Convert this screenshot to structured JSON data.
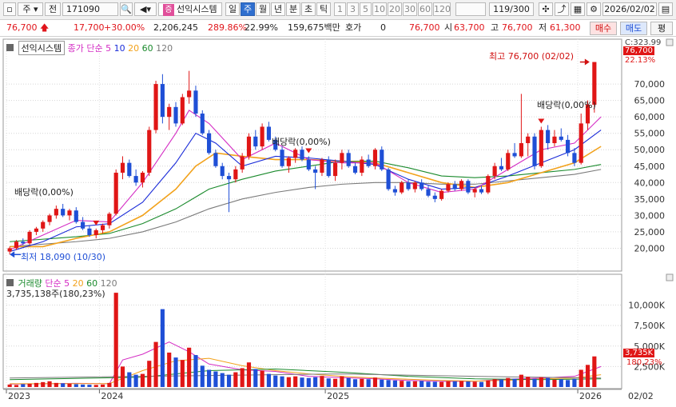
{
  "toolbar": {
    "market": "주",
    "prev_label": "전",
    "code": "171090",
    "indicator_btn": "선익시스템",
    "periods": [
      "일",
      "주",
      "월",
      "년",
      "분",
      "초",
      "틱"
    ],
    "selected_period": "주",
    "minute_options": [
      "1",
      "3",
      "5",
      "10",
      "20",
      "30",
      "60",
      "120"
    ],
    "count": "119/300",
    "date": "2026/02/02"
  },
  "quote": {
    "price": "76,700",
    "change": "17,700",
    "change_pct": "+30.00%",
    "volume": "2,206,245",
    "vol_ratio": "289.86%",
    "turnover": "22.99%",
    "amount": "159,675백만",
    "hoga_label": "호가",
    "hoga_val": "0",
    "current": "76,700",
    "open_label": "시",
    "open": "63,700",
    "high_label": "고",
    "high": "76,700",
    "low_label": "저",
    "low": "61,300",
    "buy": "매수",
    "sell": "매도",
    "eval": "평"
  },
  "price_panel": {
    "title": "선익시스템",
    "ma_label": "종가 단순",
    "ma_periods": [
      "5",
      "10",
      "20",
      "60",
      "120"
    ],
    "ma_colors": [
      "#d42cc4",
      "#1a2bd8",
      "#f2a21c",
      "#1a8a2c",
      "#7a7a7a"
    ],
    "high_note": "최고 76,700 (02/02)",
    "low_note": "최저 18,090 (10/30)",
    "dividend_notes": [
      "배당락(0,00%)",
      "배당락(0,00%)",
      "배당락(0,00%)"
    ],
    "right_top": "C:323.99",
    "price_tag": "76,700",
    "pct_tag": "22.13%",
    "y_labels": [
      "70,000",
      "65,000",
      "60,000",
      "55,000",
      "50,000",
      "45,000",
      "40,000",
      "35,000",
      "30,000",
      "25,000",
      "20,000"
    ]
  },
  "volume_panel": {
    "title": "거래량",
    "ma_label": "단순",
    "ma_periods": [
      "5",
      "20",
      "60",
      "120"
    ],
    "last_vol": "3,735,138주(180,23%)",
    "vol_tag": "3,735K",
    "vol_pct": "180,23%",
    "y_labels": [
      "10,000K",
      "7,500K",
      "5,000K",
      "2,500K"
    ]
  },
  "x_axis": {
    "labels": [
      "2023",
      "2024",
      "2025",
      "2026"
    ],
    "right_label": "02/02"
  },
  "chart_data": {
    "type": "candlestick",
    "price_range": [
      15000,
      80000
    ],
    "volume_range_k": [
      0,
      12000
    ],
    "candles": [
      {
        "o": 19000,
        "h": 20500,
        "l": 18090,
        "c": 20000
      },
      {
        "o": 20000,
        "h": 22500,
        "l": 19500,
        "c": 22000
      },
      {
        "o": 22000,
        "h": 23000,
        "l": 21000,
        "c": 21500
      },
      {
        "o": 21500,
        "h": 25500,
        "l": 21000,
        "c": 25000
      },
      {
        "o": 25000,
        "h": 26500,
        "l": 24000,
        "c": 26000
      },
      {
        "o": 26000,
        "h": 28500,
        "l": 25000,
        "c": 28000
      },
      {
        "o": 28000,
        "h": 30500,
        "l": 27000,
        "c": 30000
      },
      {
        "o": 30000,
        "h": 33000,
        "l": 29000,
        "c": 32000
      },
      {
        "o": 32000,
        "h": 33500,
        "l": 29500,
        "c": 30000
      },
      {
        "o": 30000,
        "h": 32000,
        "l": 28500,
        "c": 31500
      },
      {
        "o": 31500,
        "h": 32500,
        "l": 27500,
        "c": 28000
      },
      {
        "o": 28000,
        "h": 29500,
        "l": 25500,
        "c": 26000
      },
      {
        "o": 26000,
        "h": 27000,
        "l": 23500,
        "c": 24000
      },
      {
        "o": 24000,
        "h": 26000,
        "l": 23000,
        "c": 25500
      },
      {
        "o": 25500,
        "h": 27500,
        "l": 24500,
        "c": 27000
      },
      {
        "o": 27000,
        "h": 31000,
        "l": 26000,
        "c": 30500
      },
      {
        "o": 30500,
        "h": 44000,
        "l": 30000,
        "c": 43000
      },
      {
        "o": 43000,
        "h": 48000,
        "l": 41000,
        "c": 46000
      },
      {
        "o": 46000,
        "h": 47000,
        "l": 41500,
        "c": 42000
      },
      {
        "o": 42000,
        "h": 44000,
        "l": 39000,
        "c": 40000
      },
      {
        "o": 40000,
        "h": 43500,
        "l": 38500,
        "c": 43000
      },
      {
        "o": 43000,
        "h": 57000,
        "l": 42000,
        "c": 56000
      },
      {
        "o": 56000,
        "h": 71000,
        "l": 55000,
        "c": 70000
      },
      {
        "o": 70000,
        "h": 73000,
        "l": 58000,
        "c": 60000
      },
      {
        "o": 60000,
        "h": 64000,
        "l": 56000,
        "c": 63000
      },
      {
        "o": 63000,
        "h": 64500,
        "l": 57000,
        "c": 58000
      },
      {
        "o": 58000,
        "h": 67000,
        "l": 57500,
        "c": 66000
      },
      {
        "o": 66000,
        "h": 74000,
        "l": 64000,
        "c": 68000
      },
      {
        "o": 68000,
        "h": 69500,
        "l": 60000,
        "c": 61000
      },
      {
        "o": 61000,
        "h": 62000,
        "l": 54500,
        "c": 55000
      },
      {
        "o": 55000,
        "h": 56000,
        "l": 48500,
        "c": 49000
      },
      {
        "o": 49000,
        "h": 50000,
        "l": 44500,
        "c": 45000
      },
      {
        "o": 45000,
        "h": 46000,
        "l": 41000,
        "c": 42000
      },
      {
        "o": 42000,
        "h": 43000,
        "l": 31000,
        "c": 41000
      },
      {
        "o": 41000,
        "h": 45000,
        "l": 40000,
        "c": 44000
      },
      {
        "o": 44000,
        "h": 49000,
        "l": 43000,
        "c": 48000
      },
      {
        "o": 48000,
        "h": 55000,
        "l": 47000,
        "c": 54000
      },
      {
        "o": 54000,
        "h": 56000,
        "l": 50000,
        "c": 51000
      },
      {
        "o": 51000,
        "h": 58000,
        "l": 50000,
        "c": 57000
      },
      {
        "o": 57000,
        "h": 58500,
        "l": 52500,
        "c": 53000
      },
      {
        "o": 53000,
        "h": 54000,
        "l": 49500,
        "c": 50000
      },
      {
        "o": 50000,
        "h": 51000,
        "l": 44500,
        "c": 45000
      },
      {
        "o": 45000,
        "h": 48000,
        "l": 43000,
        "c": 47500
      },
      {
        "o": 47500,
        "h": 50500,
        "l": 46000,
        "c": 50000
      },
      {
        "o": 50000,
        "h": 51000,
        "l": 46500,
        "c": 47000
      },
      {
        "o": 47000,
        "h": 48000,
        "l": 43500,
        "c": 44000
      },
      {
        "o": 44000,
        "h": 45000,
        "l": 38000,
        "c": 43000
      },
      {
        "o": 43000,
        "h": 47500,
        "l": 42000,
        "c": 47000
      },
      {
        "o": 47000,
        "h": 48000,
        "l": 41500,
        "c": 42000
      },
      {
        "o": 42000,
        "h": 47000,
        "l": 40500,
        "c": 46000
      },
      {
        "o": 46000,
        "h": 50000,
        "l": 44000,
        "c": 49000
      },
      {
        "o": 49000,
        "h": 50000,
        "l": 44500,
        "c": 45000
      },
      {
        "o": 45000,
        "h": 46000,
        "l": 42500,
        "c": 43000
      },
      {
        "o": 43000,
        "h": 48000,
        "l": 42000,
        "c": 47000
      },
      {
        "o": 47000,
        "h": 48500,
        "l": 44500,
        "c": 45000
      },
      {
        "o": 45000,
        "h": 50500,
        "l": 44000,
        "c": 50000
      },
      {
        "o": 50000,
        "h": 51000,
        "l": 43500,
        "c": 44000
      },
      {
        "o": 44000,
        "h": 44500,
        "l": 37500,
        "c": 38000
      },
      {
        "o": 38000,
        "h": 39000,
        "l": 36000,
        "c": 37000
      },
      {
        "o": 37000,
        "h": 40500,
        "l": 36500,
        "c": 40000
      },
      {
        "o": 40000,
        "h": 41000,
        "l": 37500,
        "c": 38000
      },
      {
        "o": 38000,
        "h": 40500,
        "l": 37000,
        "c": 40000
      },
      {
        "o": 40000,
        "h": 41000,
        "l": 37500,
        "c": 38000
      },
      {
        "o": 38000,
        "h": 39000,
        "l": 35500,
        "c": 36000
      },
      {
        "o": 36000,
        "h": 37000,
        "l": 34000,
        "c": 35000
      },
      {
        "o": 35000,
        "h": 38000,
        "l": 34500,
        "c": 37500
      },
      {
        "o": 37500,
        "h": 40000,
        "l": 37000,
        "c": 39500
      },
      {
        "o": 39500,
        "h": 40500,
        "l": 37500,
        "c": 38000
      },
      {
        "o": 38000,
        "h": 41000,
        "l": 37500,
        "c": 40500
      },
      {
        "o": 40500,
        "h": 41000,
        "l": 36500,
        "c": 37000
      },
      {
        "o": 37000,
        "h": 38500,
        "l": 35500,
        "c": 38000
      },
      {
        "o": 38000,
        "h": 39000,
        "l": 36500,
        "c": 37000
      },
      {
        "o": 37000,
        "h": 42500,
        "l": 36500,
        "c": 42000
      },
      {
        "o": 42000,
        "h": 46000,
        "l": 41000,
        "c": 45000
      },
      {
        "o": 45000,
        "h": 47500,
        "l": 43500,
        "c": 44000
      },
      {
        "o": 44000,
        "h": 50000,
        "l": 43500,
        "c": 49000
      },
      {
        "o": 49000,
        "h": 52000,
        "l": 47500,
        "c": 48000
      },
      {
        "o": 48000,
        "h": 67000,
        "l": 47500,
        "c": 52000
      },
      {
        "o": 52000,
        "h": 55000,
        "l": 48000,
        "c": 54000
      },
      {
        "o": 54000,
        "h": 55000,
        "l": 44000,
        "c": 45000
      },
      {
        "o": 45000,
        "h": 57000,
        "l": 44500,
        "c": 56000
      },
      {
        "o": 56000,
        "h": 57500,
        "l": 50000,
        "c": 52000
      },
      {
        "o": 52000,
        "h": 56000,
        "l": 51000,
        "c": 54000
      },
      {
        "o": 54000,
        "h": 56500,
        "l": 52500,
        "c": 53000
      },
      {
        "o": 53000,
        "h": 54500,
        "l": 48000,
        "c": 49000
      },
      {
        "o": 49000,
        "h": 50500,
        "l": 45000,
        "c": 46000
      },
      {
        "o": 46000,
        "h": 61000,
        "l": 45500,
        "c": 58000
      },
      {
        "o": 58000,
        "h": 65000,
        "l": 56000,
        "c": 63700
      },
      {
        "o": 63700,
        "h": 76700,
        "l": 61300,
        "c": 76700
      }
    ],
    "volumes_k": [
      300,
      250,
      350,
      400,
      500,
      600,
      700,
      500,
      450,
      400,
      350,
      300,
      280,
      260,
      300,
      500,
      11500,
      2500,
      1800,
      1500,
      1600,
      3200,
      5500,
      9500,
      4200,
      3600,
      3300,
      4800,
      3900,
      2600,
      2100,
      1900,
      1700,
      1500,
      1800,
      2300,
      3000,
      2200,
      2000,
      1600,
      1400,
      1300,
      1200,
      1300,
      1150,
      1100,
      1200,
      1350,
      1050,
      1000,
      1300,
      1100,
      950,
      1000,
      950,
      1150,
      900,
      850,
      800,
      760,
      700,
      700,
      740,
      650,
      640,
      620,
      720,
      700,
      740,
      680,
      640,
      620,
      820,
      950,
      900,
      1100,
      1000,
      1500,
      1250,
      1000,
      1200,
      1100,
      900,
      950,
      850,
      1000,
      2100,
      2700,
      3735
    ],
    "ma_prices": {
      "ma5": [
        [
          0,
          19500
        ],
        [
          5,
          24000
        ],
        [
          10,
          28500
        ],
        [
          15,
          28000
        ],
        [
          20,
          40000
        ],
        [
          25,
          55000
        ],
        [
          27,
          62000
        ],
        [
          30,
          58000
        ],
        [
          35,
          47000
        ],
        [
          40,
          52000
        ],
        [
          45,
          47000
        ],
        [
          50,
          46000
        ],
        [
          55,
          46000
        ],
        [
          60,
          40000
        ],
        [
          65,
          37000
        ],
        [
          70,
          38000
        ],
        [
          75,
          44000
        ],
        [
          80,
          50000
        ],
        [
          85,
          52000
        ],
        [
          89,
          60000
        ]
      ],
      "ma10": [
        [
          0,
          19000
        ],
        [
          5,
          22000
        ],
        [
          10,
          26500
        ],
        [
          15,
          27500
        ],
        [
          20,
          34000
        ],
        [
          25,
          46000
        ],
        [
          28,
          55000
        ],
        [
          31,
          52000
        ],
        [
          35,
          45000
        ],
        [
          40,
          48000
        ],
        [
          45,
          47500
        ],
        [
          50,
          46500
        ],
        [
          55,
          45500
        ],
        [
          60,
          41000
        ],
        [
          65,
          38000
        ],
        [
          70,
          38500
        ],
        [
          75,
          42000
        ],
        [
          80,
          46000
        ],
        [
          85,
          50000
        ],
        [
          89,
          56000
        ]
      ],
      "ma20": [
        [
          0,
          20500
        ],
        [
          5,
          20500
        ],
        [
          10,
          23000
        ],
        [
          15,
          25000
        ],
        [
          20,
          30000
        ],
        [
          25,
          38000
        ],
        [
          28,
          45000
        ],
        [
          31,
          49000
        ],
        [
          35,
          48000
        ],
        [
          40,
          47000
        ],
        [
          45,
          47000
        ],
        [
          50,
          46500
        ],
        [
          55,
          46000
        ],
        [
          60,
          43000
        ],
        [
          65,
          40000
        ],
        [
          70,
          38500
        ],
        [
          75,
          40000
        ],
        [
          80,
          43000
        ],
        [
          85,
          46000
        ],
        [
          89,
          51000
        ]
      ],
      "ma60": [
        [
          0,
          22000
        ],
        [
          10,
          23500
        ],
        [
          15,
          24500
        ],
        [
          20,
          27500
        ],
        [
          25,
          32000
        ],
        [
          30,
          38000
        ],
        [
          35,
          41000
        ],
        [
          40,
          43500
        ],
        [
          45,
          45000
        ],
        [
          50,
          46500
        ],
        [
          55,
          46500
        ],
        [
          60,
          44500
        ],
        [
          65,
          42000
        ],
        [
          70,
          41500
        ],
        [
          75,
          42000
        ],
        [
          80,
          43000
        ],
        [
          85,
          44000
        ],
        [
          89,
          45500
        ]
      ],
      "ma120": [
        [
          0,
          20500
        ],
        [
          10,
          22000
        ],
        [
          15,
          23000
        ],
        [
          20,
          25000
        ],
        [
          25,
          28000
        ],
        [
          30,
          32000
        ],
        [
          35,
          35000
        ],
        [
          40,
          37000
        ],
        [
          45,
          38500
        ],
        [
          50,
          39500
        ],
        [
          55,
          40000
        ],
        [
          60,
          40000
        ],
        [
          65,
          39500
        ],
        [
          70,
          39500
        ],
        [
          75,
          40500
        ],
        [
          80,
          41500
        ],
        [
          85,
          42500
        ],
        [
          89,
          44000
        ]
      ]
    },
    "ma_volumes_k": {
      "ma5": [
        [
          0,
          350
        ],
        [
          10,
          450
        ],
        [
          15,
          400
        ],
        [
          17,
          3300
        ],
        [
          20,
          4000
        ],
        [
          24,
          5500
        ],
        [
          27,
          4300
        ],
        [
          30,
          2800
        ],
        [
          35,
          2100
        ],
        [
          40,
          1900
        ],
        [
          45,
          1300
        ],
        [
          50,
          1150
        ],
        [
          55,
          1000
        ],
        [
          60,
          800
        ],
        [
          65,
          680
        ],
        [
          70,
          700
        ],
        [
          75,
          950
        ],
        [
          80,
          1100
        ],
        [
          85,
          1300
        ],
        [
          89,
          2500
        ]
      ],
      "ma20": [
        [
          0,
          400
        ],
        [
          15,
          420
        ],
        [
          20,
          2000
        ],
        [
          25,
          3200
        ],
        [
          30,
          3500
        ],
        [
          35,
          2600
        ],
        [
          40,
          2000
        ],
        [
          45,
          1600
        ],
        [
          50,
          1300
        ],
        [
          55,
          1100
        ],
        [
          60,
          950
        ],
        [
          65,
          800
        ],
        [
          70,
          720
        ],
        [
          75,
          820
        ],
        [
          80,
          1000
        ],
        [
          85,
          1100
        ],
        [
          89,
          1500
        ]
      ],
      "ma60": [
        [
          0,
          900
        ],
        [
          20,
          1200
        ],
        [
          30,
          2000
        ],
        [
          40,
          2200
        ],
        [
          50,
          1800
        ],
        [
          60,
          1300
        ],
        [
          70,
          1000
        ],
        [
          80,
          900
        ],
        [
          89,
          1000
        ]
      ],
      "ma120": [
        [
          0,
          1100
        ],
        [
          30,
          1400
        ],
        [
          50,
          1600
        ],
        [
          70,
          1300
        ],
        [
          89,
          1100
        ]
      ]
    },
    "dividend_markers": [
      13,
      45,
      80
    ]
  }
}
